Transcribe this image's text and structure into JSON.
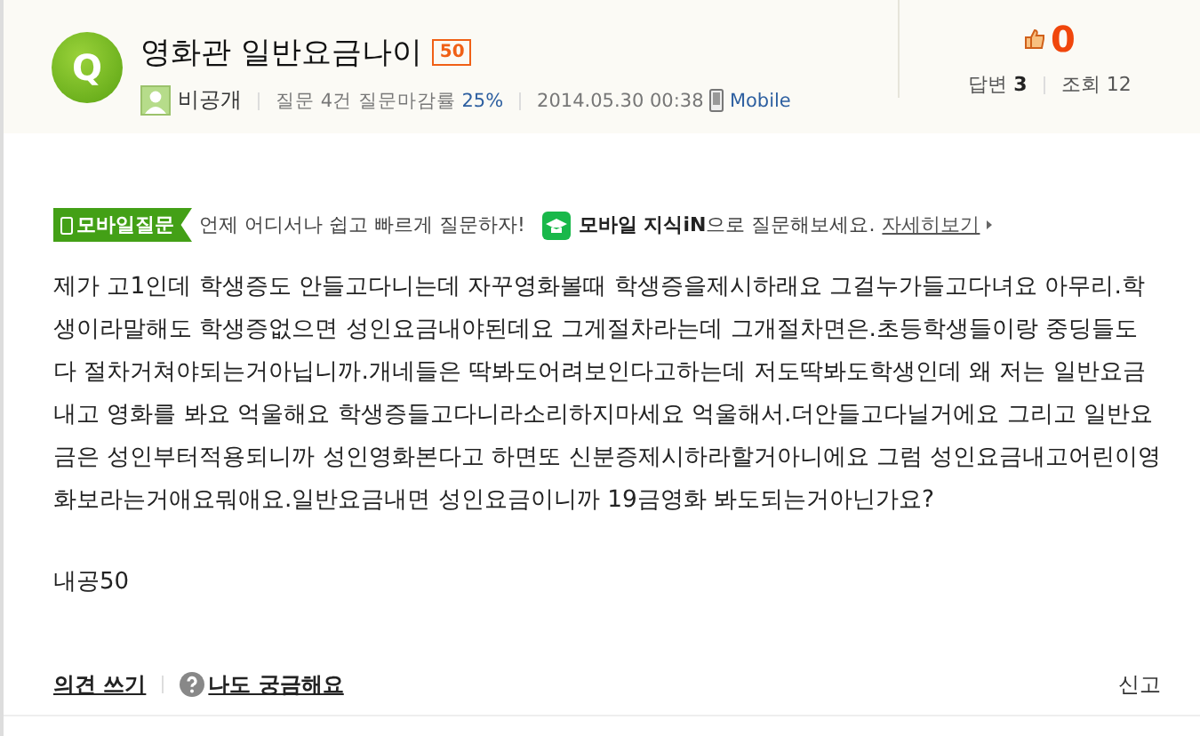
{
  "question": {
    "icon": "Q",
    "title": "영화관 일반요금나이",
    "points": "50",
    "author": "비공개",
    "stats_label": "질문 4건 질문마감률",
    "stats_rate": "25%",
    "date": "2014.05.30 00:38",
    "device": "Mobile"
  },
  "summary": {
    "likes": "0",
    "answers_label": "답변",
    "answers": "3",
    "views_label": "조회",
    "views": "12"
  },
  "banner": {
    "badge": "모바일질문",
    "text": "언제 어디서나 쉽고 빠르게 질문하자!",
    "brand": "모바일 지식iN",
    "brand_suffix": "으로 질문해보세요.",
    "link": "자세히보기"
  },
  "body_lines": [
    "제가 고1인데 학생증도 안들고다니는데 자꾸영화볼때 학생증을제시하래요 그걸누가들고다녀요 아무리.학",
    "생이라말해도 학생증없으면 성인요금내야된데요 그게절차라는데 그개절차면은.초등학생들이랑 중딩들도",
    "다 절차거쳐야되는거아닙니까.개네들은 딱봐도어려보인다고하는데 저도딱봐도학생인데 왜 저는 일반요금",
    "내고 영화를 봐요 억울해요 학생증들고다니라소리하지마세요 억울해서.더안들고다닐거에요 그리고 일반요",
    "금은 성인부터적용되니까 성인영화본다고 하면또 신분증제시하라할거아니에요 그럼 성인요금내고어린이영",
    "화보라는거애요뭐애요.일반요금내면 성인요금이니까 19금영화 봐도되는거아닌가요?"
  ],
  "reward": "내공50",
  "footer": {
    "comment": "의견 쓰기",
    "curious": "나도 궁금해요",
    "report": "신고"
  }
}
